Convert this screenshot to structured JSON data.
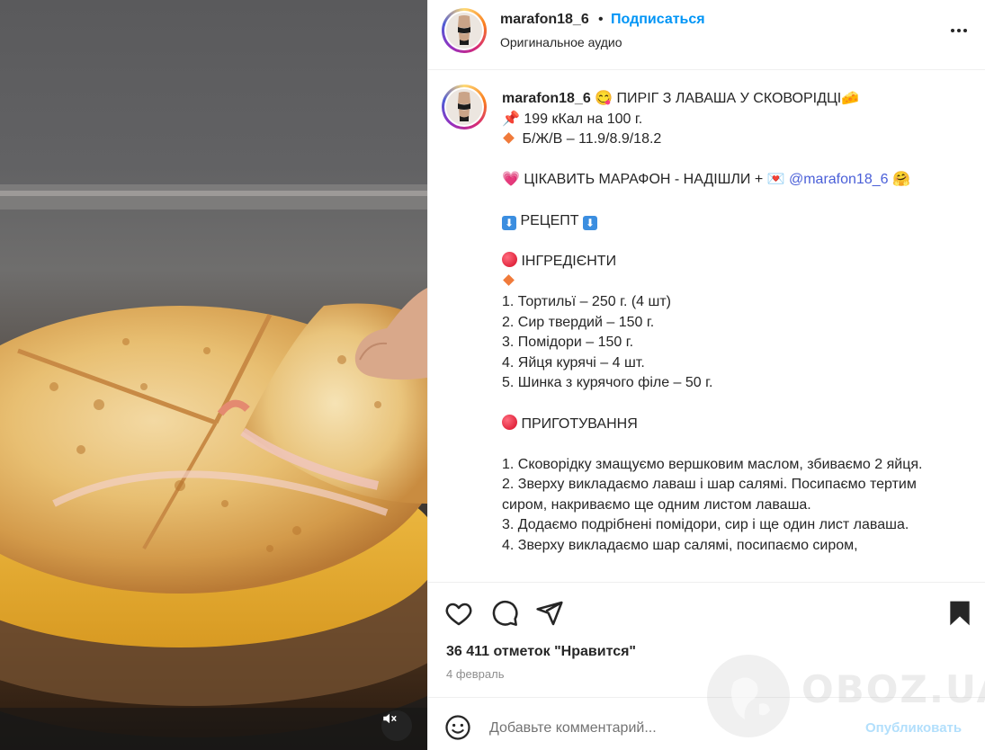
{
  "post": {
    "username": "marafon18_6",
    "follow_label": "Подписаться",
    "separator": "•",
    "audio_label": "Оригинальное аудио"
  },
  "caption": {
    "username": "marafon18_6",
    "title": "ПИРІГ З ЛАВАША У СКОВОРІДЦІ",
    "kcal": "199 кКал на 100 г.",
    "macros": "Б/Ж/В – 11.9/8.9/18.2",
    "marathon": "ЦІКАВИТЬ МАРАФОН - НАДІШЛИ +",
    "mention": "@marafon18_6",
    "recipe": "РЕЦЕПТ",
    "ingredients_title": "ІНГРЕДІЄНТИ",
    "ingredients": [
      "1. Тортильї – 250 г. (4 шт)",
      "2. Сир твердий – 150 г.",
      "3. Помідори – 150 г.",
      "4. Яйця курячі – 4 шт.",
      "5. Шинка з курячого філе – 50 г."
    ],
    "cooking_title": "ПРИГОТУВАННЯ",
    "steps": [
      "1. Сковорідку змащуємо вершковим маслом, збиваємо 2 яйця.",
      "2. Зверху викладаємо лаваш і шар салямі. Посипаємо тертим сиром, накриваємо ще одним листом лаваша.",
      "3. Додаємо подрібнені помідори, сир і ще один лист лаваша.",
      "4. Зверху викладаємо шар салямі, посипаємо сиром,"
    ]
  },
  "stats": {
    "likes": "36 411 отметок \"Нравится\"",
    "date": "4 февраль"
  },
  "comment": {
    "placeholder": "Добавьте комментарий...",
    "publish_label": "Опубликовать"
  },
  "watermark": {
    "text": "OBOZ.UA"
  },
  "icons": {
    "more": "more-options-icon",
    "like": "heart-icon",
    "comment": "comment-icon",
    "share": "share-icon",
    "save": "bookmark-icon",
    "emoji": "emoji-icon",
    "mute": "speaker-muted-icon"
  },
  "colors": {
    "link": "#0095f6",
    "mention": "#4a5fd8",
    "text": "#262626",
    "muted": "#8e8e8e",
    "publish_disabled": "#b2dffc"
  }
}
